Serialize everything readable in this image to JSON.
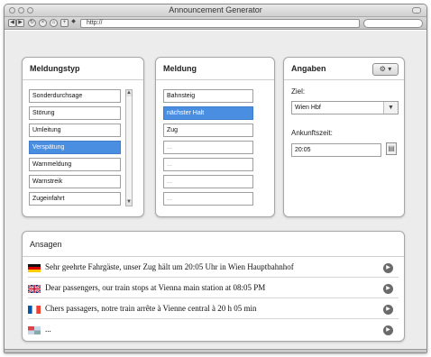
{
  "window": {
    "title": "Announcement Generator"
  },
  "toolbar": {
    "url": "http://"
  },
  "meldungstyp": {
    "title": "Meldungstyp",
    "items": [
      "Sonderdurchsage",
      "Störung",
      "Umleitung",
      "Verspätung",
      "Warnmeldung",
      "Warnstreik",
      "Zugeinfahrt"
    ],
    "selected": "Verspätung"
  },
  "meldung": {
    "title": "Meldung",
    "items": [
      "Bahnsteig",
      "nächster Halt",
      "Zug",
      "...",
      "...",
      "...",
      "..."
    ],
    "selected": "nächster Halt"
  },
  "angaben": {
    "title": "Angaben",
    "ziel_label": "Ziel:",
    "ziel_value": "Wien Hbf",
    "ankunft_label": "Ankunftszeit:",
    "ankunft_value": "20:05"
  },
  "ansagen": {
    "title": "Ansagen",
    "rows": [
      {
        "flag": "de-flag-icon",
        "text": "Sehr geehrte Fahrgäste, unser Zug hält um  20:05  Uhr in Wien Hauptbahnhof"
      },
      {
        "flag": "uk-flag-icon",
        "text": "Dear passengers, our train stops at Vienna main station at  08:05  PM"
      },
      {
        "flag": "fr-flag-icon",
        "text": "Chers passagers, notre train arrête à Vienne central à  20 h 05 min"
      },
      {
        "flag": "multi-flag-icon",
        "text": "..."
      }
    ]
  },
  "colors": {
    "selection": "#4a8ee2",
    "background": "#ececec",
    "play": "#6a6a6a"
  }
}
